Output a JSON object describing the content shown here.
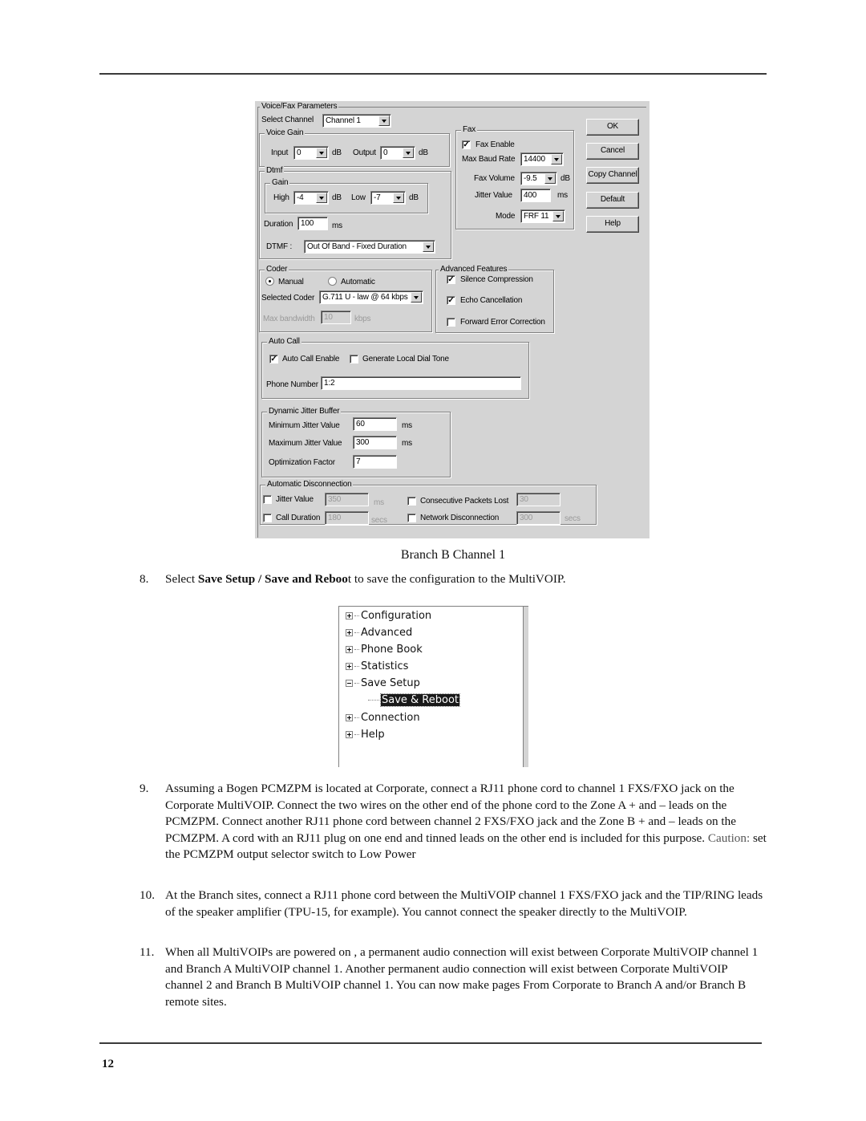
{
  "dialog": {
    "group_title": "Voice/Fax Parameters",
    "select_channel": {
      "label": "Select Channel",
      "value": "Channel 1"
    },
    "voice_gain": {
      "title": "Voice Gain",
      "input": {
        "label": "Input",
        "value": "0",
        "unit": "dB"
      },
      "output": {
        "label": "Output",
        "value": "0",
        "unit": "dB"
      }
    },
    "dtmf": {
      "title": "Dtmf",
      "gain_title": "Gain",
      "high": {
        "label": "High",
        "value": "-4",
        "unit": "dB"
      },
      "low": {
        "label": "Low",
        "value": "-7",
        "unit": "dB"
      },
      "duration": {
        "label": "Duration",
        "value": "100",
        "unit": "ms"
      },
      "mode": {
        "label": "DTMF :",
        "value": "Out Of Band - Fixed Duration"
      }
    },
    "fax": {
      "title": "Fax",
      "enable": {
        "label": "Fax Enable",
        "checked": true
      },
      "max_baud_rate": {
        "label": "Max Baud Rate",
        "value": "14400"
      },
      "fax_volume": {
        "label": "Fax Volume",
        "value": "-9.5",
        "unit": "dB"
      },
      "jitter_value": {
        "label": "Jitter Value",
        "value": "400",
        "unit": "ms"
      },
      "mode": {
        "label": "Mode",
        "value": "FRF 11"
      }
    },
    "buttons": {
      "ok": "OK",
      "cancel": "Cancel",
      "copy_channel": "Copy Channel",
      "default": "Default",
      "help": "Help"
    },
    "coder": {
      "title": "Coder",
      "manual": {
        "label": "Manual",
        "selected": true
      },
      "automatic": {
        "label": "Automatic",
        "selected": false
      },
      "selected_coder": {
        "label": "Selected Coder",
        "value": "G.711 U - law @ 64 kbps"
      },
      "max_bandwidth": {
        "label": "Max bandwidth",
        "value": "10",
        "unit": "kbps"
      }
    },
    "advanced_features": {
      "title": "Advanced Features",
      "silence_compression": {
        "label": "Silence Compression",
        "checked": true
      },
      "echo_cancellation": {
        "label": "Echo Cancellation",
        "checked": true
      },
      "forward_error_correction": {
        "label": "Forward Error Correction",
        "checked": false
      }
    },
    "auto_call": {
      "title": "Auto Call",
      "enable": {
        "label": "Auto Call Enable",
        "checked": true
      },
      "local_dial_tone": {
        "label": "Generate Local Dial Tone",
        "checked": false
      },
      "phone_number": {
        "label": "Phone Number",
        "value": "1:2"
      }
    },
    "jitter_buffer": {
      "title": "Dynamic Jitter Buffer",
      "min": {
        "label": "Minimum Jitter Value",
        "value": "60",
        "unit": "ms"
      },
      "max": {
        "label": "Maximum Jitter Value",
        "value": "300",
        "unit": "ms"
      },
      "optimization": {
        "label": "Optimization Factor",
        "value": "7"
      }
    },
    "auto_disconnect": {
      "title": "Automatic Disconnection",
      "jitter_value": {
        "label": "Jitter Value",
        "value": "350",
        "unit": "ms",
        "checked": false
      },
      "call_duration": {
        "label": "Call Duration",
        "value": "180",
        "unit": "secs",
        "checked": false
      },
      "packets_lost": {
        "label": "Consecutive Packets Lost",
        "value": "30",
        "checked": false
      },
      "network_disconnect": {
        "label": "Network Disconnection",
        "value": "300",
        "unit": "secs",
        "checked": false
      }
    }
  },
  "figure_caption": "Branch B Channel 1",
  "steps": [
    {
      "num": "8.",
      "pre": "Select ",
      "bold": "Save Setup / Save and Reboo",
      "post": "t to save the configuration to the MultiVOIP."
    },
    {
      "num": "9.",
      "text": "Assuming a Bogen PCMZPM is located at Corporate, connect a RJ11 phone cord to channel 1 FXS/FXO jack on the Corporate MultiVOIP. Connect the two wires on the other end of the phone cord to the Zone A + and – leads on the PCMZPM. Connect another RJ11 phone cord between channel 2 FXS/FXO jack and the Zone B + and – leads on the PCMZPM. A cord with an RJ11 plug on one end and tinned leads on the other end is included for this purpose. ",
      "caution": "Caution:",
      "post": " set the PCMZPM output selector switch to Low Power"
    },
    {
      "num": "10.",
      "text": "At the Branch sites, connect a RJ11 phone cord between the MultiVOIP channel 1 FXS/FXO jack and the TIP/RING leads of the speaker amplifier (TPU-15, for example). You cannot connect the speaker directly to the MultiVOIP."
    },
    {
      "num": "11.",
      "text": "When all MultiVOIPs are powered on , a permanent audio connection will exist between Corporate MultiVOIP channel 1 and Branch A MultiVOIP channel 1.  Another permanent audio connection will exist between Corporate MultiVOIP channel 2 and Branch B MultiVOIP channel 1.  You can now make pages From Corporate to Branch A and/or Branch B remote sites."
    }
  ],
  "tree": {
    "items": [
      {
        "label": "Configuration",
        "expanded": false
      },
      {
        "label": "Advanced",
        "expanded": false
      },
      {
        "label": "Phone Book",
        "expanded": false
      },
      {
        "label": "Statistics",
        "expanded": false
      },
      {
        "label": "Save Setup",
        "expanded": true
      },
      {
        "label": "Save & Reboot",
        "child": true,
        "selected": true
      },
      {
        "label": "Connection",
        "expanded": false
      },
      {
        "label": "Help",
        "expanded": false
      }
    ]
  },
  "page_number": "12"
}
